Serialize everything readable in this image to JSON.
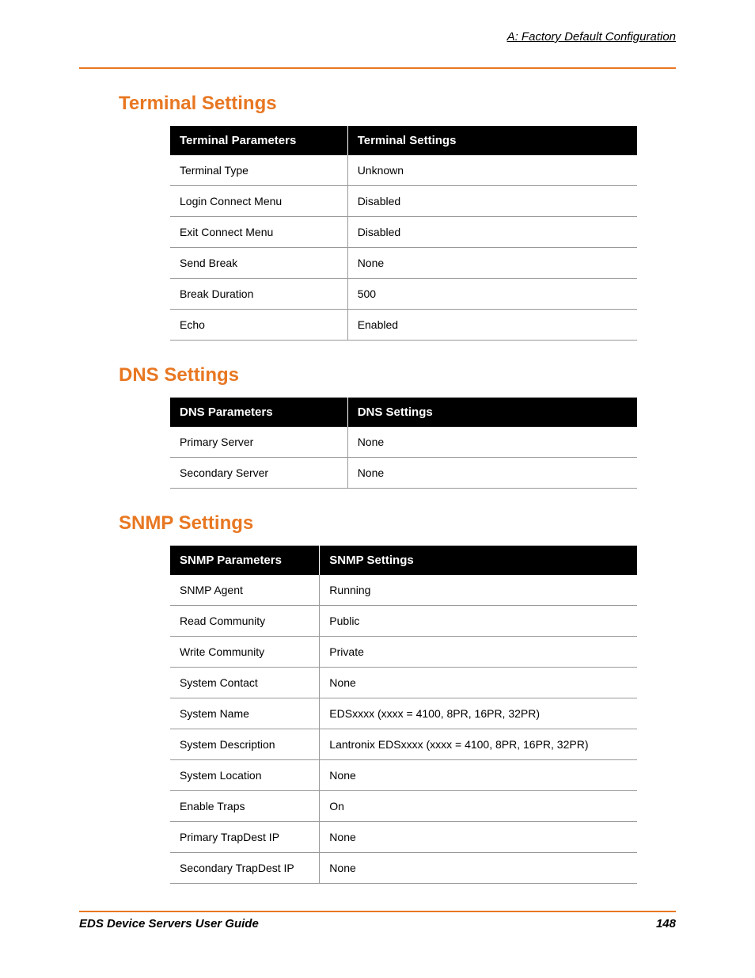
{
  "header": {
    "right_label": "A: Factory Default Configuration"
  },
  "sections": {
    "terminal": {
      "heading": "Terminal Settings",
      "cols": [
        "Terminal Parameters",
        "Terminal Settings"
      ],
      "rows": [
        {
          "param": "Terminal Type",
          "value": "Unknown"
        },
        {
          "param": "Login Connect Menu",
          "value": "Disabled"
        },
        {
          "param": "Exit Connect Menu",
          "value": "Disabled"
        },
        {
          "param": "Send Break",
          "value": "None"
        },
        {
          "param": "Break Duration",
          "value": "500"
        },
        {
          "param": "Echo",
          "value": "Enabled"
        }
      ]
    },
    "dns": {
      "heading": "DNS Settings",
      "cols": [
        "DNS Parameters",
        "DNS Settings"
      ],
      "rows": [
        {
          "param": "Primary Server",
          "value": "None"
        },
        {
          "param": "Secondary Server",
          "value": "None"
        }
      ]
    },
    "snmp": {
      "heading": "SNMP Settings",
      "cols": [
        "SNMP Parameters",
        "SNMP Settings"
      ],
      "rows": [
        {
          "param": "SNMP Agent",
          "value": "Running"
        },
        {
          "param": "Read Community",
          "value": "Public"
        },
        {
          "param": "Write Community",
          "value": "Private"
        },
        {
          "param": "System Contact",
          "value": "None"
        },
        {
          "param": "System Name",
          "value": "EDSxxxx (xxxx = 4100, 8PR, 16PR, 32PR)"
        },
        {
          "param": "System Description",
          "value": "Lantronix EDSxxxx (xxxx = 4100, 8PR, 16PR, 32PR)"
        },
        {
          "param": "System Location",
          "value": "None"
        },
        {
          "param": "Enable Traps",
          "value": "On"
        },
        {
          "param": "Primary TrapDest IP",
          "value": "None"
        },
        {
          "param": "Secondary TrapDest IP",
          "value": "None"
        }
      ]
    }
  },
  "footer": {
    "left": "EDS Device Servers User Guide",
    "right": "148"
  },
  "snmp_col_widths": {
    "param": "32%",
    "value": "68%"
  },
  "default_col_widths": {
    "param": "38%",
    "value": "62%"
  }
}
